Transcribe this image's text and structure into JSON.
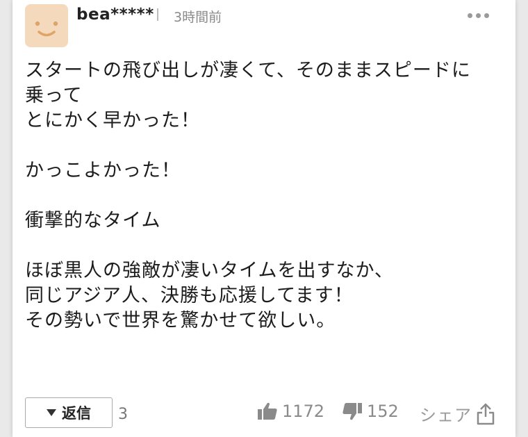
{
  "comment": {
    "username": "bea*****",
    "time": "3時間前",
    "more_icon": "more-horizontal-icon",
    "body": "スタートの飛び出しが凄くて、そのままスピードに\n乗って\nとにかく早かった！\n\nかっこよかった！\n\n衝撃的なタイム\n\nほぼ黒人の強敵が凄いタイムを出すなか、\n同じアジア人、決勝も応援してます！\nその勢いで世界を驚かせて欲しい。"
  },
  "footer": {
    "reply_label": "返信",
    "reply_count": "3",
    "likes": "1172",
    "dislikes": "152",
    "share_label": "シェア"
  },
  "colors": {
    "avatar_bg": "#f4d9bd",
    "avatar_face": "#e0a469",
    "muted_text": "#8a8a8a"
  }
}
